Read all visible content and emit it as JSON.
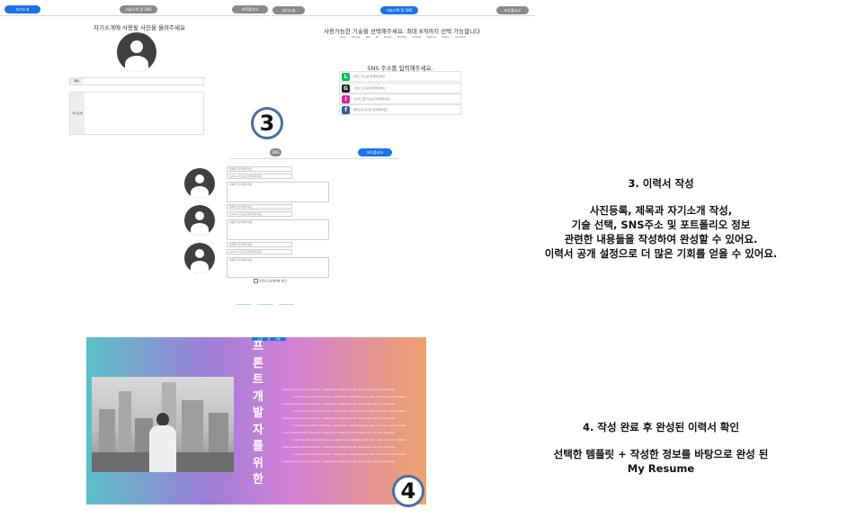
{
  "screen3": {
    "tabs_left": [
      "자기소개",
      "기술스택 및 SNS",
      "포트폴리오"
    ],
    "tabs_right": [
      "자기소개",
      "기술스택 및 SNS",
      "포트폴리오"
    ],
    "photo_prompt": "자기소개에 사용될 사진을 올려주세요",
    "title_label": "제목",
    "intro_label": "자기소개",
    "skills_prompt": "사용가능한 기술을 선택해주세요. 최대 8개까지 선택 가능합니다",
    "skills": [
      "Java",
      "Spring",
      "JPA",
      "JS",
      "React",
      "MySQL",
      "Oracle",
      "Python",
      "Kotlin",
      "Android"
    ],
    "sns_prompt": "SNS 주소를 입력해주세요.",
    "sns_items": [
      {
        "icon": "L",
        "color": "#06c755",
        "placeholder": "블로그 주소를 입력해주세요"
      },
      {
        "icon": "G",
        "color": "#222222",
        "placeholder": "깃허브 주소를 입력해주세요"
      },
      {
        "icon": "I",
        "color": "#d6249f",
        "placeholder": "인스타그램 주소를 입력해주세요"
      },
      {
        "icon": "f",
        "color": "#3b5998",
        "placeholder": "페이스북 주소를 입력해주세요"
      }
    ],
    "badge": "3",
    "portfolio_prev": "SNS",
    "portfolio_done": "포트폴리오",
    "portfolio_fields": [
      {
        "f1": "제목을 입력해주세요",
        "f2": "github 주소를 입력해주세요",
        "f3": "내용을 입력해주세요"
      },
      {
        "f1": "제목을 입력해주세요",
        "f2": "github 주소를 입력해주세요",
        "f3": "내용을 입력해주세요"
      },
      {
        "f1": "제목을 입력해주세요",
        "f2": "github 주소를 입력해주세요",
        "f3": "내용을 입력해주세요"
      }
    ],
    "public_checkbox": "이력서 공개여부 체크",
    "description": {
      "heading": "3. 이력서 작성",
      "lines": [
        "사진등록, 제목과 자기소개 작성,",
        "기술 선택, SNS주소 및 포트폴리오 정보",
        "관련한 내용들을 작성하여 완성할 수 있어요.",
        "이력서 공개 설정으로 더 많은 기회를 얻을 수 있어요."
      ]
    }
  },
  "screen4": {
    "badge": "4",
    "vertical_title": [
      "프",
      "론",
      "트",
      "개",
      "발",
      "자",
      "를",
      "위",
      "한"
    ],
    "top_buttons": [
      "수정",
      "삭제"
    ],
    "placeholder_text": "Lorem ipsum dolor sit amet, consectetur adipiscing elit. Sed porta nec dui molestie",
    "description": {
      "heading": "4. 작성 완료 후 완성된 이력서 확인",
      "lines": [
        "선택한 템플릿 + 작성한 정보를 바탕으로 완성 된",
        "My Resume"
      ]
    }
  }
}
